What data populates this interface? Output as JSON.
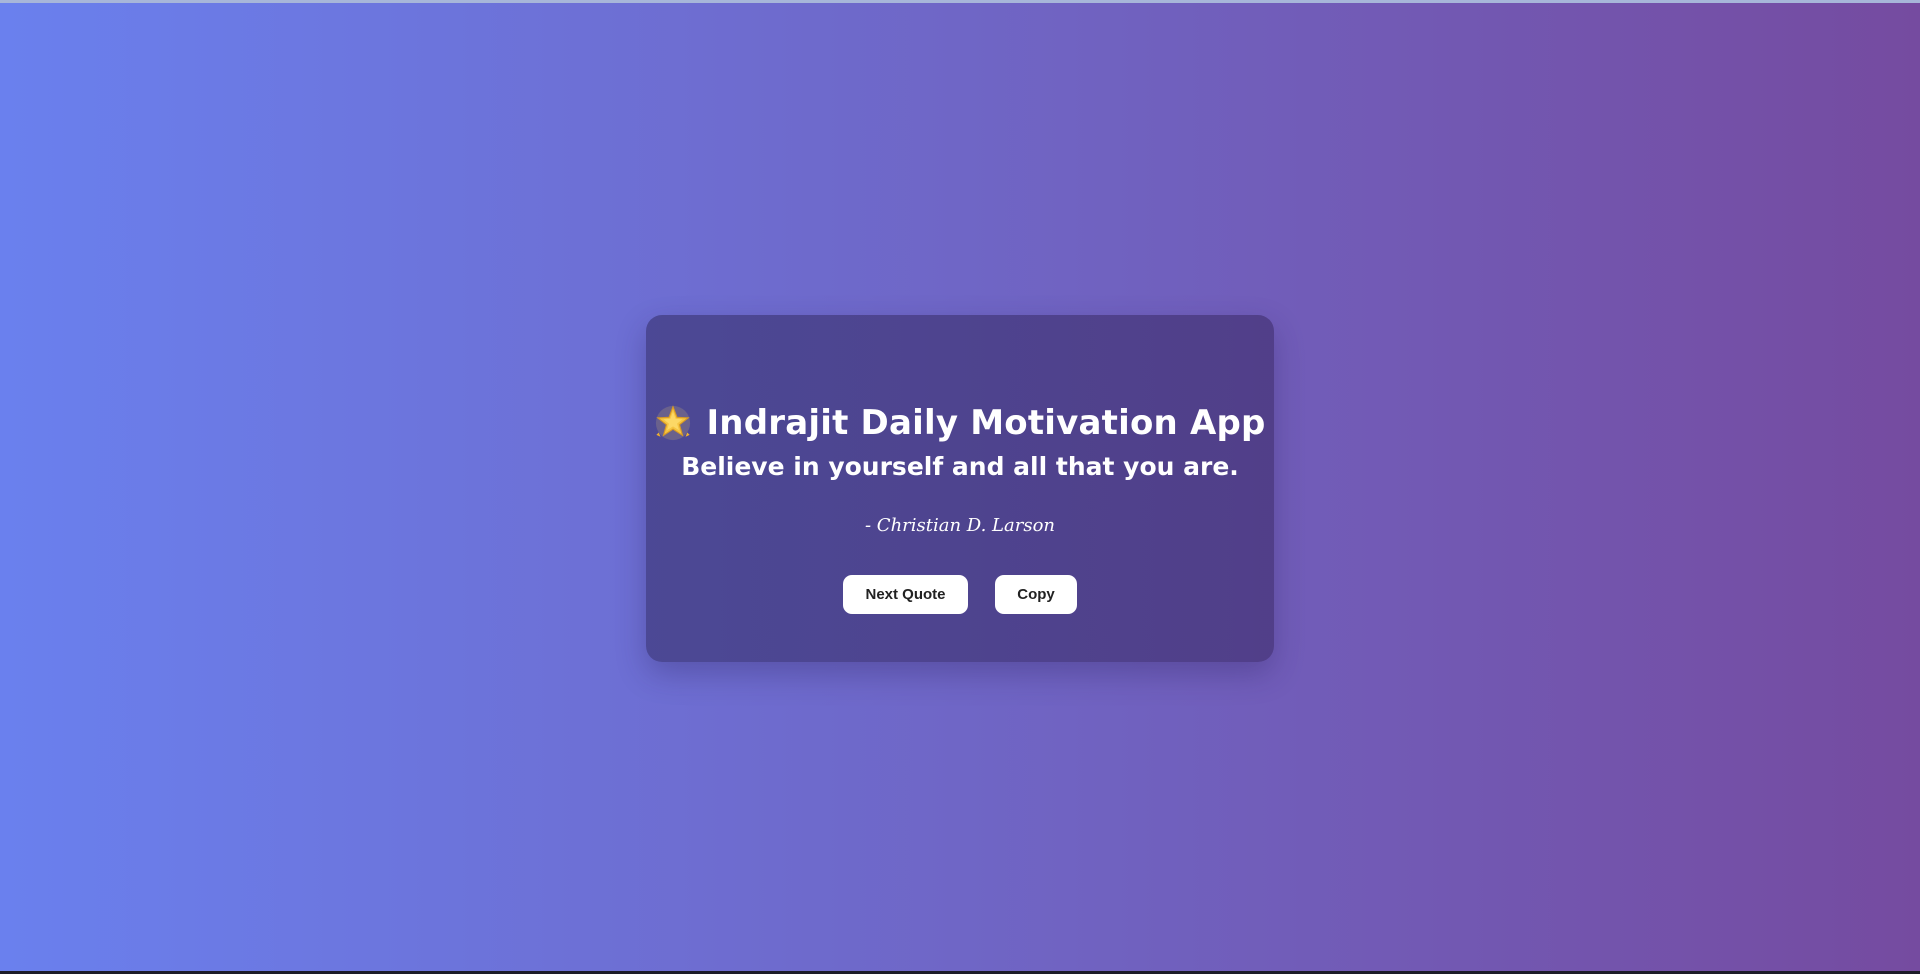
{
  "app": {
    "title": "Indrajit Daily Motivation App",
    "icon": "glowing-star-icon"
  },
  "quote": {
    "text": "Believe in yourself and all that you are.",
    "author": "- Christian D. Larson"
  },
  "buttons": {
    "next_label": "Next Quote",
    "copy_label": "Copy"
  },
  "colors": {
    "background_start": "#6a80ee",
    "background_end": "#754ba0",
    "card": "#463d86",
    "button": "#ffffff",
    "button_text": "#222222"
  }
}
